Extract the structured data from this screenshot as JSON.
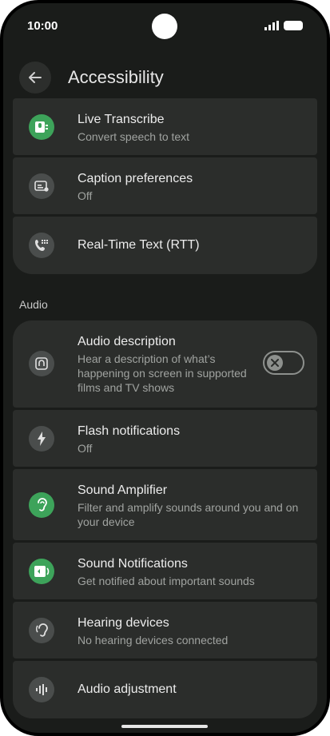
{
  "status_bar": {
    "time": "10:00"
  },
  "header": {
    "title": "Accessibility"
  },
  "top_group": [
    {
      "title": "Live Transcribe",
      "subtitle": "Convert speech to text",
      "icon": "live-transcribe-icon"
    },
    {
      "title": "Caption preferences",
      "subtitle": "Off",
      "icon": "caption-icon"
    },
    {
      "title": "Real-Time Text (RTT)",
      "subtitle": "",
      "icon": "rtt-icon"
    }
  ],
  "audio_section": {
    "label": "Audio",
    "items": [
      {
        "title": "Audio description",
        "subtitle": "Hear a description of what’s happening on screen in supported films and TV shows",
        "icon": "audio-description-icon",
        "toggle_on": false
      },
      {
        "title": "Flash notifications",
        "subtitle": "Off",
        "icon": "flash-icon"
      },
      {
        "title": "Sound Amplifier",
        "subtitle": "Filter and amplify sounds around you and on your device",
        "icon": "ear-icon"
      },
      {
        "title": "Sound Notifications",
        "subtitle": "Get notified about important sounds",
        "icon": "sound-notification-icon"
      },
      {
        "title": "Hearing devices",
        "subtitle": "No hearing devices connected",
        "icon": "hearing-device-icon"
      },
      {
        "title": "Audio adjustment",
        "subtitle": "",
        "icon": "audio-adjust-icon"
      }
    ]
  },
  "colors": {
    "background": "#1a1c1a",
    "card": "#2b2d2b",
    "accent_green": "#3da35a",
    "icon_gray": "#4a4d4c"
  }
}
